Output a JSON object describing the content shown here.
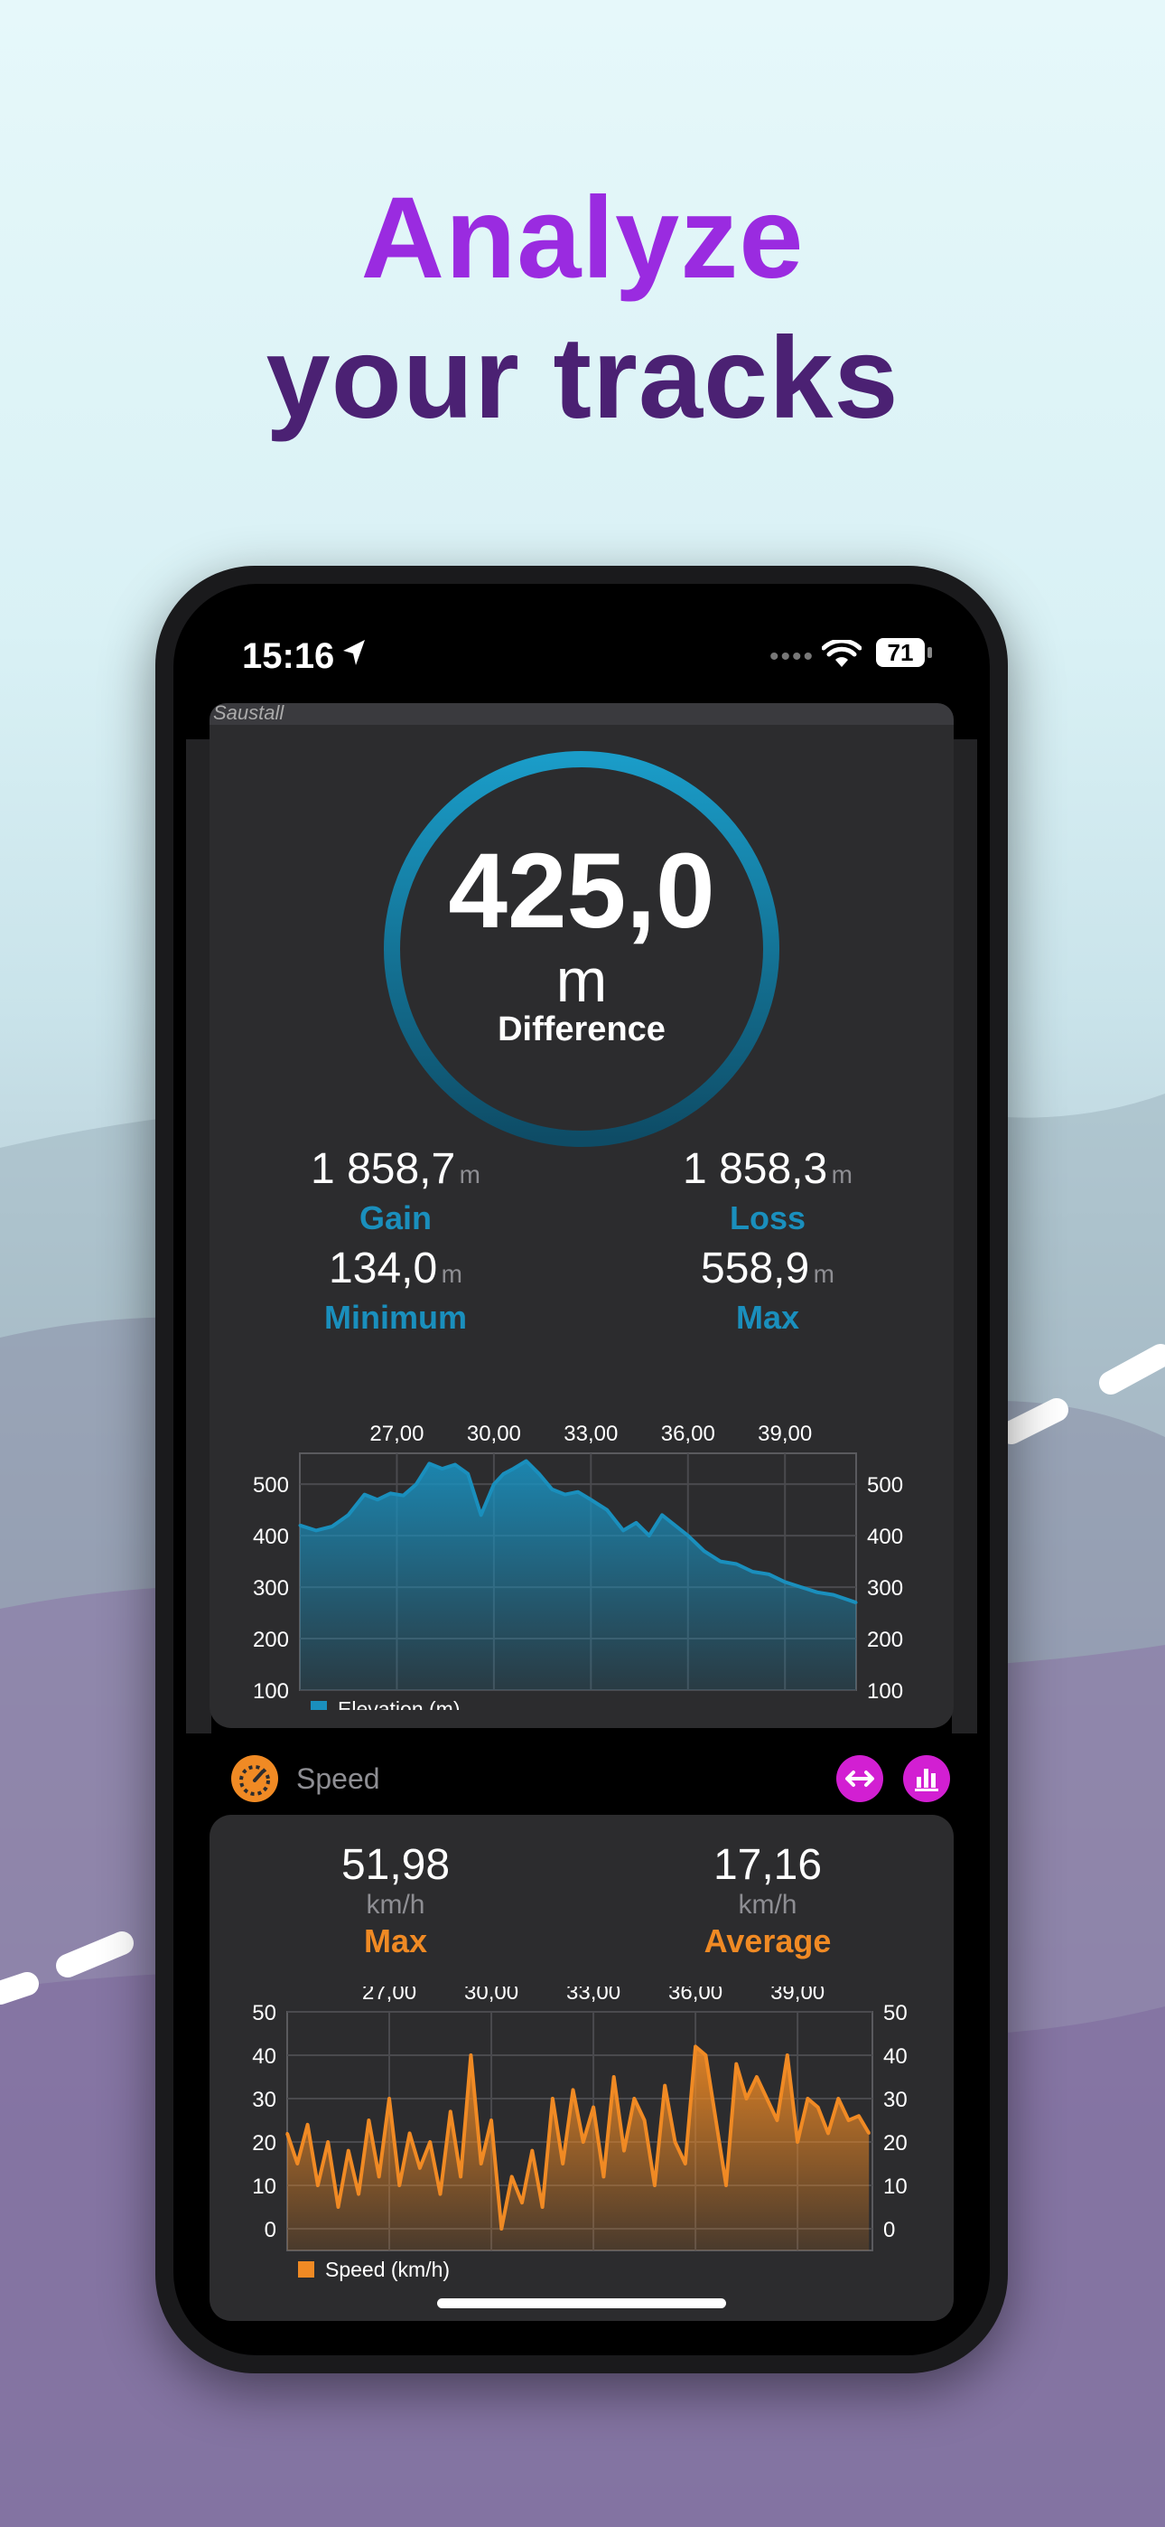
{
  "headline": {
    "line1": "Analyze",
    "line2": "your tracks"
  },
  "status_bar": {
    "time": "15:16",
    "battery": "71"
  },
  "map": {
    "place_label": "Saustall"
  },
  "elevation": {
    "difference_value": "425,0",
    "difference_unit": "m",
    "difference_label": "Difference",
    "gain_value": "1 858,7",
    "gain_unit": "m",
    "gain_label": "Gain",
    "loss_value": "1 858,3",
    "loss_unit": "m",
    "loss_label": "Loss",
    "min_value": "134,0",
    "min_unit": "m",
    "min_label": "Minimum",
    "max_value": "558,9",
    "max_unit": "m",
    "max_label": "Max"
  },
  "speed": {
    "section_title": "Speed",
    "max_value": "51,98",
    "max_unit": "km/h",
    "max_label": "Max",
    "avg_value": "17,16",
    "avg_unit": "km/h",
    "avg_label": "Average"
  },
  "colors": {
    "accent_blue": "#1a8fbd",
    "accent_orange": "#f08a24",
    "button_magenta": "#d21fd2",
    "headline_purple": "#9a2be0"
  },
  "icons": [
    "location-arrow-icon",
    "wifi-icon",
    "battery-icon",
    "speedometer-icon",
    "expand-horizontal-icon",
    "bar-chart-icon"
  ],
  "chart_data": [
    {
      "type": "area",
      "legend": "Elevation (m)",
      "x_ticks": [
        "27,00",
        "30,00",
        "33,00",
        "36,00",
        "39,00"
      ],
      "y_ticks": [
        500,
        400,
        300,
        200,
        100
      ],
      "ylim": [
        100,
        560
      ],
      "xlim": [
        24,
        41.2
      ],
      "color": "#1a8fbd",
      "x": [
        24.0,
        24.5,
        25.0,
        25.5,
        26.0,
        26.4,
        26.8,
        27.2,
        27.6,
        28.0,
        28.4,
        28.8,
        29.2,
        29.6,
        30.0,
        30.3,
        30.6,
        31.0,
        31.4,
        31.8,
        32.2,
        32.6,
        33.0,
        33.5,
        34.0,
        34.4,
        34.8,
        35.2,
        35.6,
        36.0,
        36.5,
        37.0,
        37.5,
        38.0,
        38.5,
        39.0,
        39.5,
        40.0,
        40.5,
        41.2
      ],
      "values": [
        420,
        410,
        418,
        440,
        480,
        470,
        482,
        478,
        500,
        540,
        530,
        538,
        520,
        440,
        500,
        520,
        530,
        545,
        520,
        490,
        480,
        485,
        470,
        450,
        410,
        425,
        400,
        440,
        420,
        400,
        370,
        350,
        345,
        330,
        325,
        310,
        300,
        290,
        285,
        270
      ]
    },
    {
      "type": "area",
      "legend": "Speed (km/h)",
      "x_ticks": [
        "27,00",
        "30,00",
        "33,00",
        "36,00",
        "39,00"
      ],
      "y_ticks": [
        50,
        40,
        30,
        20,
        10,
        0
      ],
      "ylim": [
        -5,
        50
      ],
      "xlim": [
        24,
        41.2
      ],
      "color": "#f08a24",
      "x": [
        24.0,
        24.3,
        24.6,
        24.9,
        25.2,
        25.5,
        25.8,
        26.1,
        26.4,
        26.7,
        27.0,
        27.3,
        27.6,
        27.9,
        28.2,
        28.5,
        28.8,
        29.1,
        29.4,
        29.7,
        30.0,
        30.3,
        30.6,
        30.9,
        31.2,
        31.5,
        31.8,
        32.1,
        32.4,
        32.7,
        33.0,
        33.3,
        33.6,
        33.9,
        34.2,
        34.5,
        34.8,
        35.1,
        35.4,
        35.7,
        36.0,
        36.3,
        36.6,
        36.9,
        37.2,
        37.5,
        37.8,
        38.1,
        38.4,
        38.7,
        39.0,
        39.3,
        39.6,
        39.9,
        40.2,
        40.5,
        40.8,
        41.1
      ],
      "values": [
        22,
        15,
        24,
        10,
        20,
        5,
        18,
        8,
        25,
        12,
        30,
        10,
        22,
        14,
        20,
        8,
        27,
        12,
        40,
        15,
        25,
        0,
        12,
        6,
        18,
        5,
        30,
        15,
        32,
        20,
        28,
        12,
        35,
        18,
        30,
        25,
        10,
        33,
        20,
        15,
        42,
        40,
        25,
        10,
        38,
        30,
        35,
        30,
        25,
        40,
        20,
        30,
        28,
        22,
        30,
        25,
        26,
        22
      ]
    }
  ]
}
